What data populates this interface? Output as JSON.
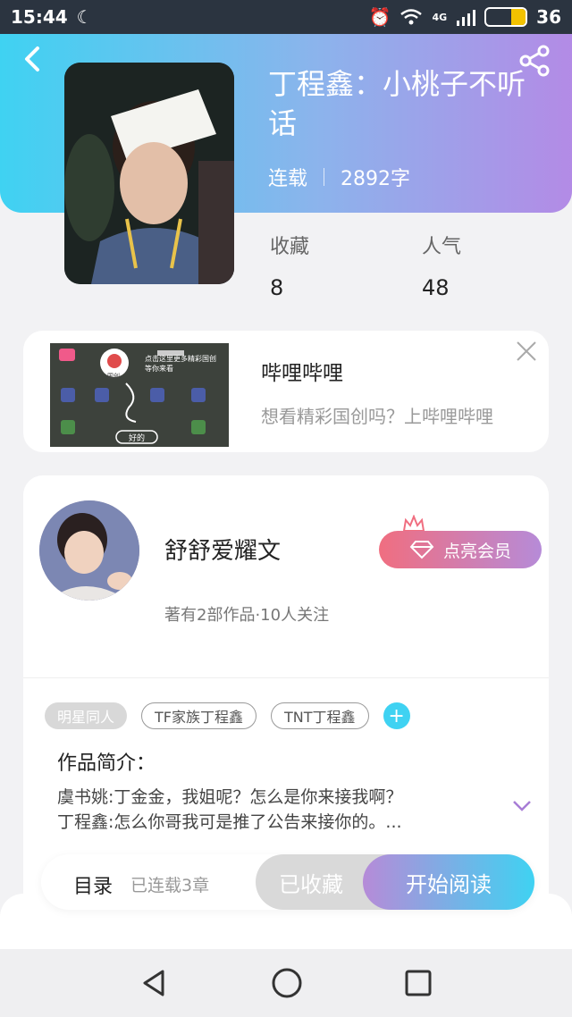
{
  "status_bar": {
    "time": "15:44",
    "network": "4G",
    "battery": "36",
    "battery_level": 0.36
  },
  "book": {
    "title": "丁程鑫：小桃子不听话",
    "status": "连载",
    "word_count": "2892字",
    "stats": [
      {
        "label": "收藏",
        "value": "8"
      },
      {
        "label": "人气",
        "value": "48"
      }
    ]
  },
  "ad": {
    "title": "哔哩哔哩",
    "desc": "想看精彩国创吗？上哔哩哔哩",
    "thumb_caption": "点击这里更多精彩国创等你来看",
    "thumb_badge": "国创",
    "thumb_button": "好的"
  },
  "author": {
    "name": "舒舒爱耀文",
    "stats": "著有2部作品·10人关注",
    "vip_label": "点亮会员"
  },
  "tags": [
    "明星同人",
    "TF家族丁程鑫",
    "TNT丁程鑫"
  ],
  "intro": {
    "label": "作品简介：",
    "lines": [
      "虞书姚:丁金金，我姐呢？怎么是你来接我啊？",
      "丁程鑫:怎么你哥我可是推了公告来接你的。..."
    ]
  },
  "bottom_bar": {
    "toc_label": "目录",
    "toc_count": "已连载3章",
    "fav_label": "已收藏",
    "read_label": "开始阅读"
  },
  "colors": {
    "cyan": "#3fd2f2",
    "purple": "#b68bd8",
    "pink": "#f06e80"
  },
  "icons": [
    "back-arrow-icon",
    "share-icon",
    "close-icon",
    "crown-icon",
    "diamond-icon",
    "plus-icon",
    "chevron-down-icon",
    "nav-back-icon",
    "nav-home-icon",
    "nav-recents-icon"
  ]
}
